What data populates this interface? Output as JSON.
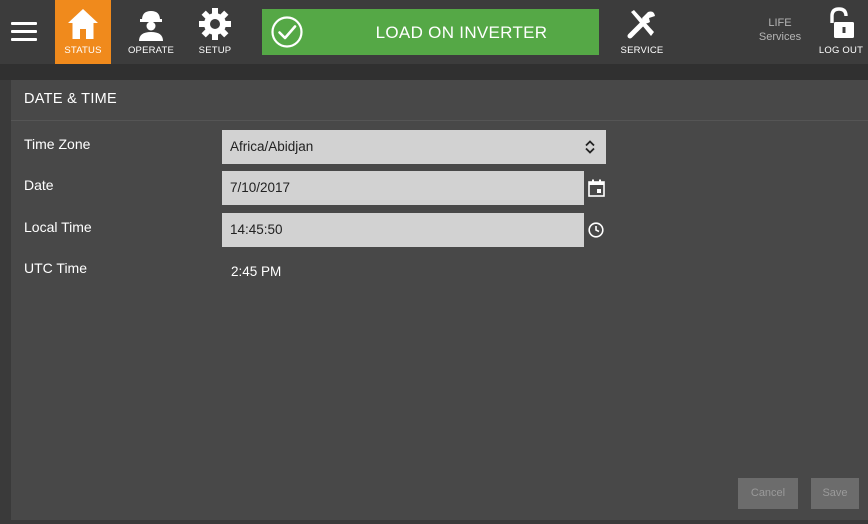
{
  "nav": {
    "menu_icon": "hamburger-icon",
    "status_label": "STATUS",
    "status_icon": "home-icon",
    "operate_label": "OPERATE",
    "operate_icon": "operator-icon",
    "setup_label": "SETUP",
    "setup_icon": "gear-icon",
    "banner_text": "LOAD ON INVERTER",
    "banner_icon": "checkmark-circle-icon",
    "service_label": "SERVICE",
    "service_icon": "tools-icon",
    "life_line1": "LIFE",
    "life_line2": "Services",
    "logout_label": "LOG OUT",
    "logout_icon": "unlock-icon"
  },
  "panel": {
    "title": "DATE & TIME",
    "fields": {
      "time_zone": {
        "label": "Time Zone",
        "value": "Africa/Abidjan"
      },
      "date": {
        "label": "Date",
        "value": "7/10/2017"
      },
      "local_time": {
        "label": "Local Time",
        "value": "14:45:50"
      },
      "utc_time": {
        "label": "UTC Time",
        "value": "2:45 PM"
      }
    }
  },
  "buttons": {
    "cancel": "Cancel",
    "save": "Save"
  },
  "colors": {
    "accent_orange": "#f08a1c",
    "banner_green": "#55a846",
    "panel_bg": "#484848",
    "topbar_bg": "#3c3c3c",
    "field_bg": "#d2d2d2"
  }
}
